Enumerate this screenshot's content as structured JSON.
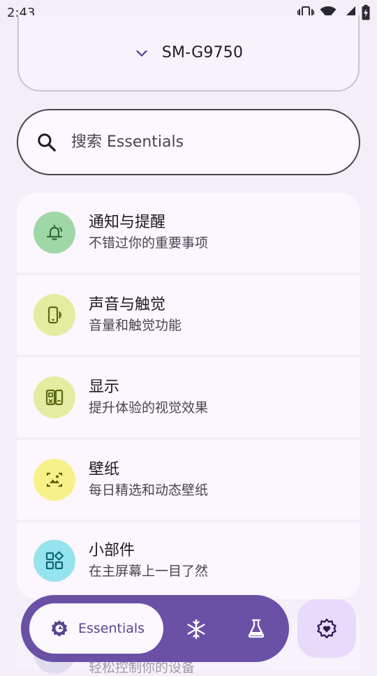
{
  "status_bar": {
    "time": "2:43",
    "icons": [
      "vibrate-icon",
      "wifi-icon",
      "cell-signal-icon",
      "battery-charging-icon"
    ]
  },
  "device": {
    "name": "SM-G9750",
    "icon": "chevron-down-icon"
  },
  "search": {
    "placeholder": "搜索 Essentials",
    "value": ""
  },
  "categories": [
    {
      "title": "通知与提醒",
      "subtitle": "不错过你的重要事项",
      "icon": "notification-bell-icon",
      "bg": "#9fd8a6",
      "fg": "#2c6a3c"
    },
    {
      "title": "声音与触觉",
      "subtitle": "音量和触觉功能",
      "icon": "phone-vibration-icon",
      "bg": "#e4eca2",
      "fg": "#5b6a12"
    },
    {
      "title": "显示",
      "subtitle": "提升体验的视觉效果",
      "icon": "display-devices-icon",
      "bg": "#e4eca2",
      "fg": "#5b6a12"
    },
    {
      "title": "壁纸",
      "subtitle": "每日精选和动态壁纸",
      "icon": "wallpaper-image-icon",
      "bg": "#f8f18a",
      "fg": "#6a5f06"
    },
    {
      "title": "小部件",
      "subtitle": "在主屏幕上一目了然",
      "icon": "widgets-icon",
      "bg": "#95e3ec",
      "fg": "#0d6872"
    }
  ],
  "peek_item": {
    "subtitle": "轻松控制你的设备"
  },
  "bottom_nav": {
    "active_label": "Essentials",
    "items": [
      "essentials-gear-icon",
      "snowflake-icon",
      "flask-icon"
    ],
    "accent": "#6a51a6"
  },
  "fab": {
    "icon": "settings-gear-icon",
    "bg": "#e7dbfb"
  }
}
